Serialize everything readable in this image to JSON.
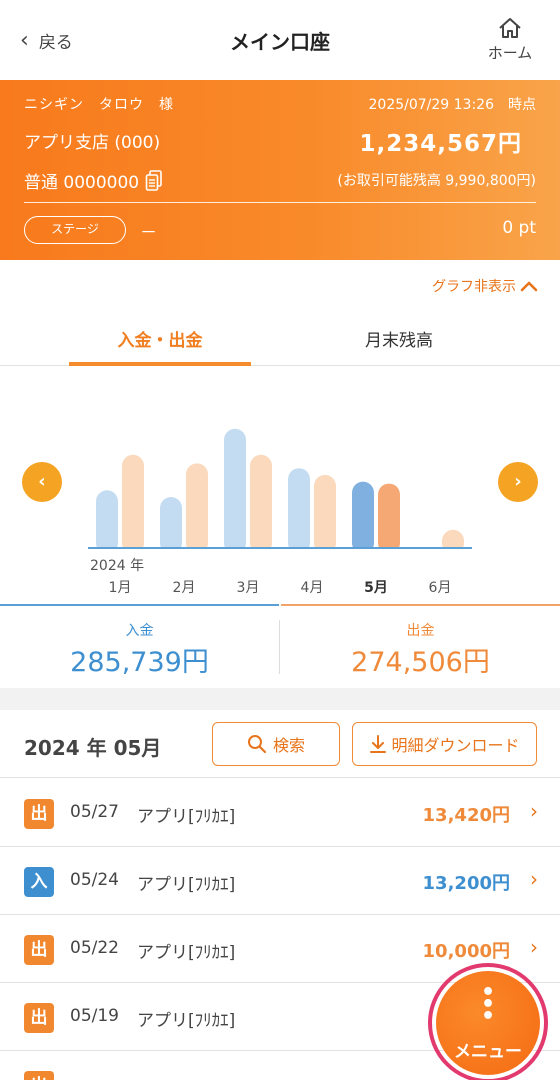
{
  "nav": {
    "back_label": "戻る",
    "title": "メイン口座",
    "home_label": "ホーム"
  },
  "account": {
    "name": "ニシギン　タロウ　様",
    "timestamp": "2025/07/29 13:26　時点",
    "branch": "アプリ支店 (000)",
    "balance": "1,234,567円",
    "account_number": "普通 0000000",
    "available": "(お取引可能残高 9,990,800円)",
    "stage_label": "ステージ",
    "stage_value": "－",
    "points": "0 pt"
  },
  "graph_toggle": {
    "label": "グラフ非表示"
  },
  "tabs": [
    {
      "label": "入金・出金"
    },
    {
      "label": "月末残高"
    }
  ],
  "chart_data": {
    "type": "bar",
    "year_label": "2024 年",
    "categories": [
      "1月",
      "2月",
      "3月",
      "4月",
      "5月",
      "6月"
    ],
    "selected_index": 4,
    "series": [
      {
        "name": "入金",
        "values": [
          60,
          53,
          124,
          83,
          69,
          0
        ]
      },
      {
        "name": "出金",
        "values": [
          97,
          88,
          97,
          76,
          67,
          19
        ]
      }
    ],
    "ylim": [
      0,
      130
    ],
    "colors": {
      "deposit": "#c4dcf1",
      "deposit_selected": "#7fb0e0",
      "withdrawal": "#fbd9bd",
      "withdrawal_selected": "#f6a874",
      "axis": "#5a9fd6"
    }
  },
  "totals": {
    "deposit_label": "入金",
    "deposit_value": "285,739円",
    "withdrawal_label": "出金",
    "withdrawal_value": "274,506円"
  },
  "month_section": {
    "title": "2024 年 05月",
    "search_label": "検索",
    "download_label": "明細ダウンロード"
  },
  "transactions": [
    {
      "type": "出",
      "kind": "out",
      "date": "05/27",
      "desc": "アプリ[ﾌﾘｶｴ]",
      "amount": "13,420円"
    },
    {
      "type": "入",
      "kind": "in",
      "date": "05/24",
      "desc": "アプリ[ﾌﾘｶｴ]",
      "amount": "13,200円"
    },
    {
      "type": "出",
      "kind": "out",
      "date": "05/22",
      "desc": "アプリ[ﾌﾘｶｴ]",
      "amount": "10,000円"
    },
    {
      "type": "出",
      "kind": "out",
      "date": "05/19",
      "desc": "アプリ[ﾌﾘｶｴ]",
      "amount": ""
    },
    {
      "type": "出",
      "kind": "out",
      "date": "",
      "desc": "",
      "amount": ""
    }
  ],
  "fab": {
    "label": "メニュー"
  }
}
